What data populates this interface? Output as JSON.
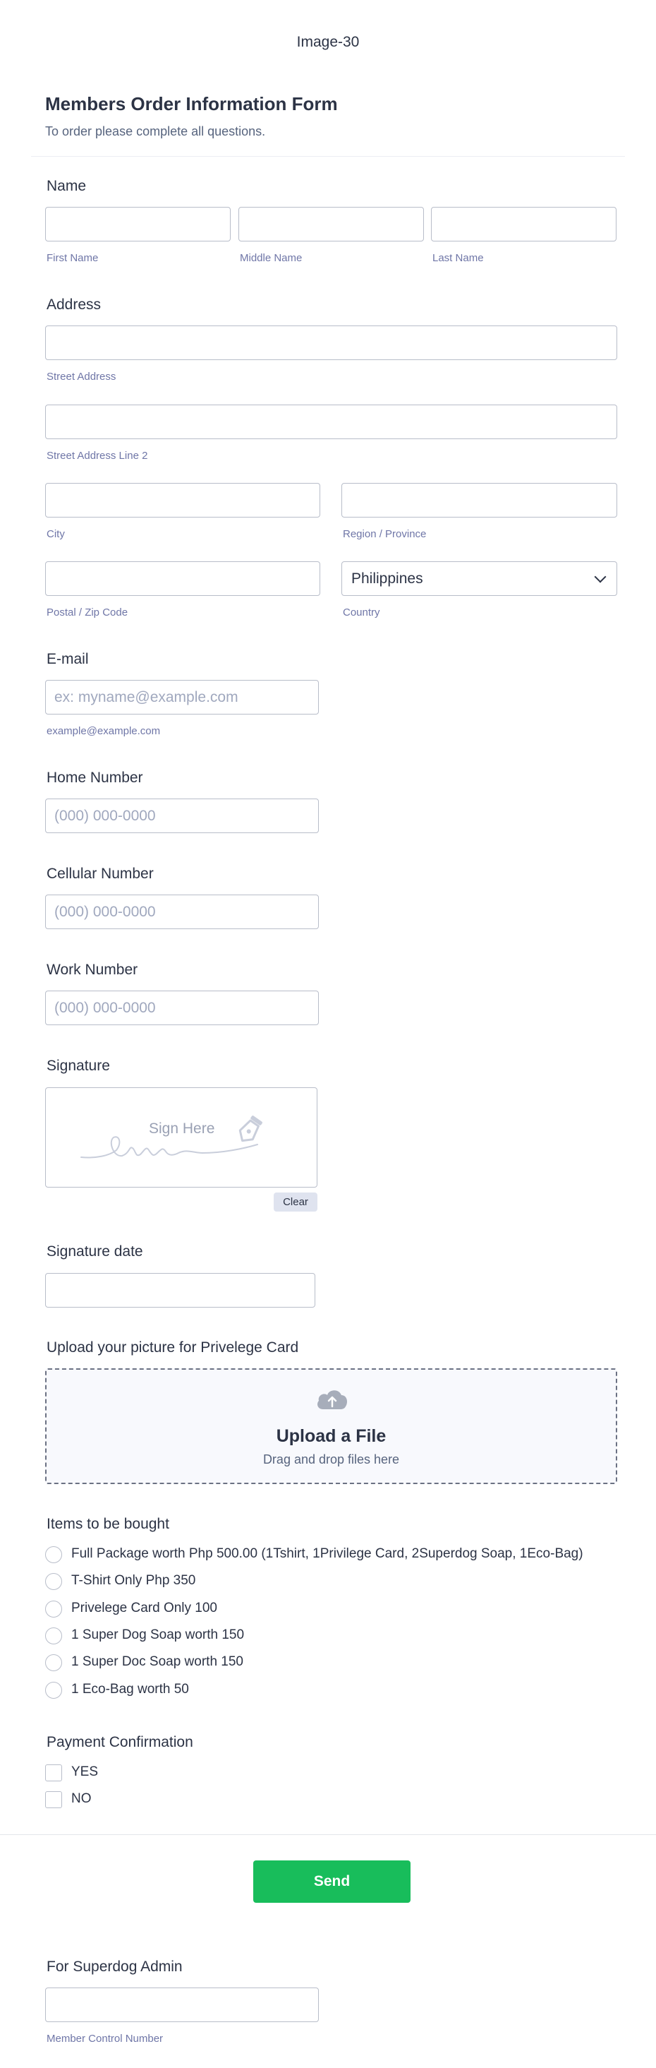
{
  "header": {
    "image_alt": "Image-30"
  },
  "form": {
    "title": "Members Order Information Form",
    "subtitle": "To order please complete all questions."
  },
  "name": {
    "label": "Name",
    "first": "First Name",
    "middle": "Middle Name",
    "last": "Last Name"
  },
  "address": {
    "label": "Address",
    "street": "Street Address",
    "street2": "Street Address Line 2",
    "city": "City",
    "region": "Region / Province",
    "postal": "Postal / Zip Code",
    "country_label": "Country",
    "country_value": "Philippines"
  },
  "email": {
    "label": "E-mail",
    "placeholder": "ex: myname@example.com",
    "sublabel": "example@example.com"
  },
  "home_number": {
    "label": "Home Number",
    "placeholder": "(000) 000-0000"
  },
  "cell_number": {
    "label": "Cellular Number",
    "placeholder": "(000) 000-0000"
  },
  "work_number": {
    "label": "Work Number",
    "placeholder": "(000) 000-0000"
  },
  "signature": {
    "label": "Signature",
    "sign_here": "Sign Here",
    "clear": "Clear"
  },
  "signature_date": {
    "label": "Signature date"
  },
  "upload": {
    "label": "Upload your picture for Privelege Card",
    "title": "Upload a File",
    "subtitle": "Drag and drop files here"
  },
  "items": {
    "label": "Items to be bought",
    "options": [
      "Full Package worth Php 500.00 (1Tshirt, 1Privilege Card, 2Superdog Soap, 1Eco-Bag)",
      "T-Shirt Only Php 350",
      "Privelege Card Only 100",
      "1 Super Dog Soap worth 150",
      "1 Super Doc Soap worth 150",
      "1 Eco-Bag worth 50"
    ]
  },
  "payment": {
    "label": "Payment Confirmation",
    "options": [
      "YES",
      "NO"
    ]
  },
  "send": {
    "label": "Send"
  },
  "admin": {
    "label": "For Superdog Admin",
    "sublabel": "Member Control Number"
  },
  "colors": {
    "accent": "#18bd5b",
    "text": "#2c3345",
    "border": "#b8bdc9"
  }
}
